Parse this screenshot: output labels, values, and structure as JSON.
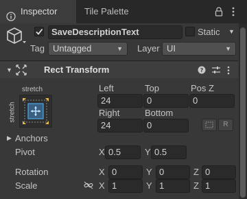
{
  "tabs": [
    {
      "label": "Inspector",
      "icon": "info-icon"
    },
    {
      "label": "Tile Palette"
    }
  ],
  "gameobject": {
    "active": true,
    "name": "SaveDescriptionText",
    "static_label": "Static",
    "static": false,
    "tag_label": "Tag",
    "tag_value": "Untagged",
    "layer_label": "Layer",
    "layer_value": "UI"
  },
  "component": {
    "title": "Rect Transform",
    "anchor_preset_label_h": "stretch",
    "anchor_preset_label_v": "stretch",
    "left_label": "Left",
    "top_label": "Top",
    "posz_label": "Pos Z",
    "left": "24",
    "top": "0",
    "posz": "0",
    "right_label": "Right",
    "bottom_label": "Bottom",
    "right": "24",
    "bottom": "0",
    "r_button": "R",
    "anchors_label": "Anchors",
    "pivot_label": "Pivot",
    "pivot_x": "0.5",
    "pivot_y": "0.5",
    "rotation_label": "Rotation",
    "rot_x": "0",
    "rot_y": "0",
    "rot_z": "0",
    "scale_label": "Scale",
    "scale_x": "1",
    "scale_y": "1",
    "scale_z": "1",
    "axis_x": "X",
    "axis_y": "Y",
    "axis_z": "Z"
  },
  "colors": {
    "background": "#383838",
    "accent_anchor": "#4aa8e8"
  }
}
